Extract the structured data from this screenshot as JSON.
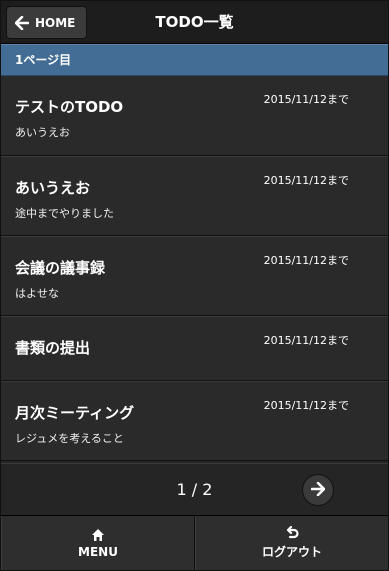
{
  "header": {
    "home_label": "HOME",
    "title": "TODO一覧",
    "home_icon": "arrow-left-icon"
  },
  "page_divider": "1ページ目",
  "todos": [
    {
      "title": "テストのTODO",
      "description": "あいうえお",
      "due": "2015/11/12まで"
    },
    {
      "title": "あいうえお",
      "description": "途中までやりました",
      "due": "2015/11/12まで"
    },
    {
      "title": "会議の議事録",
      "description": "はよせな",
      "due": "2015/11/12まで"
    },
    {
      "title": "書類の提出",
      "description": "",
      "due": "2015/11/12まで"
    },
    {
      "title": "月次ミーティング",
      "description": "レジュメを考えること",
      "due": "2015/11/12まで"
    }
  ],
  "pager": {
    "text": "1 / 2",
    "next_icon": "arrow-right-icon"
  },
  "footer": {
    "menu_label": "MENU",
    "menu_icon": "home-icon",
    "logout_label": "ログアウト",
    "logout_icon": "undo-icon"
  },
  "colors": {
    "divider": "#446d96",
    "background": "#252525"
  }
}
